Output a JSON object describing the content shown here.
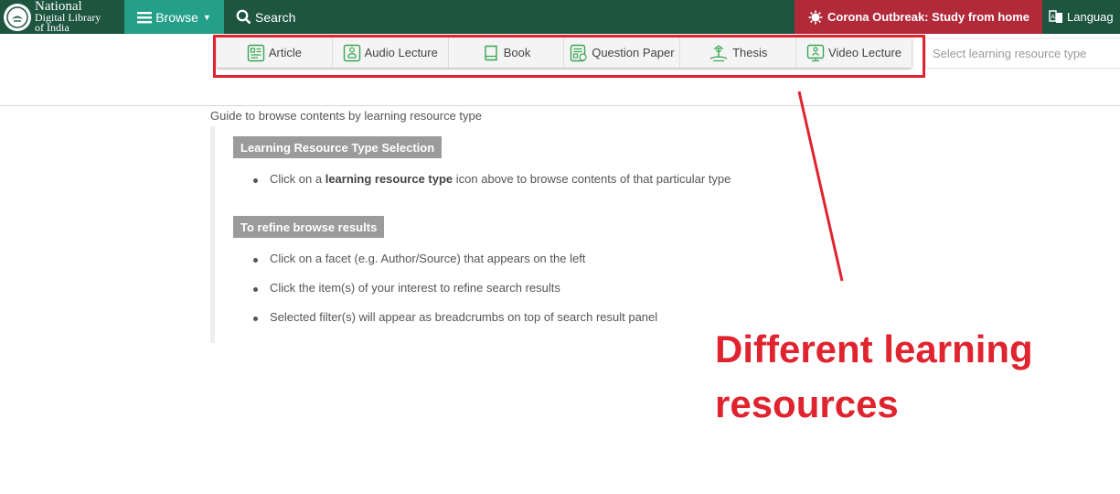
{
  "header": {
    "logo": {
      "line1": "National",
      "line2": "Digital Library",
      "line3": "of India"
    },
    "browse_label": "Browse",
    "search_label": "Search",
    "corona_label": "Corona Outbreak: Study from home",
    "language_label": "Languag"
  },
  "resource_types": [
    {
      "label": "Article",
      "icon": "article-icon"
    },
    {
      "label": "Audio Lecture",
      "icon": "audio-lecture-icon"
    },
    {
      "label": "Book",
      "icon": "book-icon"
    },
    {
      "label": "Question Paper",
      "icon": "question-paper-icon"
    },
    {
      "label": "Thesis",
      "icon": "thesis-icon"
    },
    {
      "label": "Video Lecture",
      "icon": "video-lecture-icon"
    }
  ],
  "select_placeholder": "Select learning resource type",
  "guide": {
    "title": "Guide to browse contents by learning resource type",
    "section1": {
      "heading": "Learning Resource Type Selection",
      "bullet_pre": "Click on a ",
      "bullet_bold": "learning resource type",
      "bullet_post": " icon above to browse contents of that particular type"
    },
    "section2": {
      "heading": "To refine browse results",
      "bullets": [
        "Click on a facet (e.g. Author/Source) that appears on the left",
        "Click the item(s) of your interest to refine search results",
        "Selected filter(s) will appear as breadcrumbs on top of search result panel"
      ]
    }
  },
  "annotation": {
    "line1": "Different learning",
    "line2": "resources"
  },
  "colors": {
    "topbar": "#1d5540",
    "browse": "#24a089",
    "corona": "#b22a3a",
    "annotation": "#e0242f",
    "icon": "#3aa655"
  }
}
